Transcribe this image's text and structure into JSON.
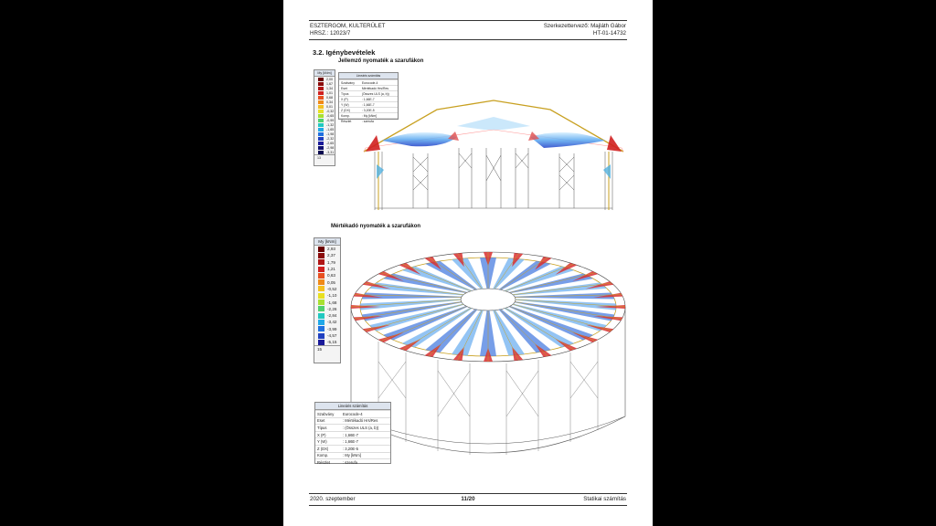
{
  "header": {
    "left_line1": "ESZTERGOM, KULTERÜLET",
    "left_line2": "HRSZ.: 12023/7",
    "right_line1": "Szerkezettervező: Majláth Gábor",
    "right_line2": "HT-01-14732"
  },
  "section_title": "3.2. Igénybevételek",
  "figure1_caption": "Jellemző nyomaték a szarufákon",
  "figure2_caption": "Mértékadó nyomaték a szarufákon",
  "legend_small": {
    "title": "My [kNm]",
    "values": [
      "2,00",
      "1,67",
      "1,34",
      "1,01",
      "0,68",
      "0,34",
      "0,01",
      "-0,32",
      "-0,65",
      "-0,99",
      "-1,32",
      "-1,65",
      "-1,98",
      "-2,32",
      "-2,65",
      "-2,98",
      "-3,31"
    ],
    "foot": "13"
  },
  "legend_big": {
    "title": "My [kNm]",
    "values": [
      "2,93",
      "2,37",
      "1,79",
      "1,21",
      "0,63",
      "0,05",
      "-0,52",
      "-1,10",
      "-1,68",
      "-2,26",
      "-2,84",
      "-3,42",
      "-3,99",
      "-4,57",
      "-5,15"
    ],
    "foot": "15"
  },
  "legend_colors": [
    "#6b0000",
    "#8b0a0a",
    "#b01515",
    "#d02020",
    "#e85020",
    "#f08a18",
    "#f5c020",
    "#e8e020",
    "#a8e030",
    "#50d070",
    "#20c8c0",
    "#20a8e8",
    "#2070e0",
    "#2040c0",
    "#1a1a9a",
    "#101070",
    "#0a0a50"
  ],
  "info_small": {
    "title": "Lineáris számítás",
    "rows": [
      [
        "Szabvány",
        "Eurocode-4"
      ],
      [
        "Eset",
        "Mértékadó Hrs/Res"
      ],
      [
        "Típus",
        "(Összes ULS (a, b))"
      ],
      [
        "X (P)",
        ": 1,66E-7"
      ],
      [
        "Y (W)",
        ": 1,66E-7"
      ],
      [
        "Z (DX)",
        ": 3,20E-5"
      ],
      [
        "Komp.",
        ": My [kNm]"
      ],
      [
        "Részlet",
        ": szerufa"
      ]
    ]
  },
  "info_big": {
    "title": "Lineáris számítás",
    "rows": [
      [
        "Szabvány",
        "Eurocode-4"
      ],
      [
        "Eset",
        ": Mértékadó Hrs/Res"
      ],
      [
        "Típus",
        ": (Összes ULS (a, b))"
      ],
      [
        "X (P)",
        ": 1,66E-7"
      ],
      [
        "Y (W)",
        ": 1,66E-7"
      ],
      [
        "Z (DX)",
        ": 3,20E-5"
      ],
      [
        "Komp.",
        ": My [kNm]"
      ],
      [
        "Részlet",
        ": szerufa"
      ]
    ]
  },
  "footer": {
    "left": "2020. szeptember",
    "center": "11/20",
    "right": "Statikai számítás"
  }
}
